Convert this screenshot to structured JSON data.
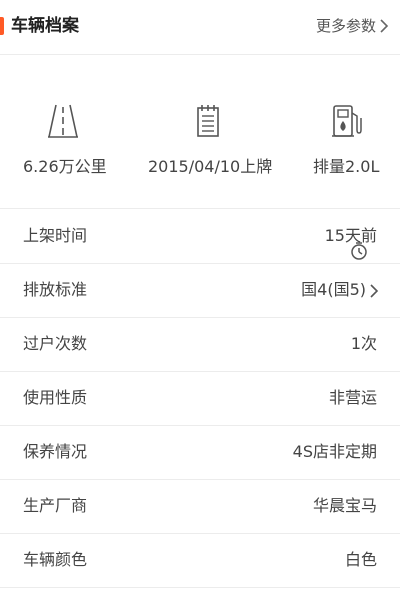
{
  "header": {
    "title": "车辆档案",
    "more_label": "更多参数",
    "accent_color": "#ff5a26"
  },
  "summary": [
    {
      "icon": "road-icon",
      "text": "6.26万公里"
    },
    {
      "icon": "calendar-icon",
      "text": "2015/04/10上牌"
    },
    {
      "icon": "fuel-pump-icon",
      "text": "排量2.0L"
    }
  ],
  "rows": [
    {
      "label": "上架时间",
      "value": "15天前"
    },
    {
      "label": "排放标准",
      "value": "国4(国5)"
    },
    {
      "label": "过户次数",
      "value": "1次"
    },
    {
      "label": "使用性质",
      "value": "非营运"
    },
    {
      "label": "保养情况",
      "value": "4S店非定期"
    },
    {
      "label": "生产厂商",
      "value": "华晨宝马"
    },
    {
      "label": "车辆颜色",
      "value": "白色"
    }
  ]
}
